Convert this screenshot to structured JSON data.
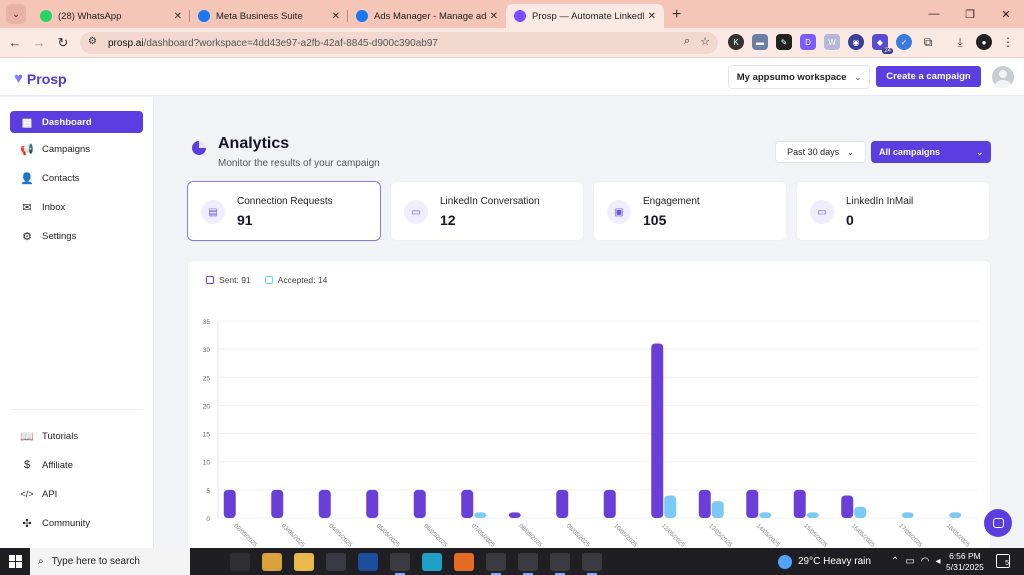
{
  "browser": {
    "tabs": [
      {
        "title": "(28) WhatsApp",
        "color": "#25d366"
      },
      {
        "title": "Meta Business Suite",
        "color": "#1877f2"
      },
      {
        "title": "Ads Manager - Manage ads - C",
        "color": "#1877f2"
      },
      {
        "title": "Prosp — Automate LinkedIn &",
        "color": "#7b4dff"
      }
    ],
    "url_host": "prosp.ai",
    "url_path": "/dashboard?workspace=4dd43e97-a2fb-42af-8845-d900c390ab97",
    "extension_badge": "24"
  },
  "header": {
    "logo": "Prosp",
    "workspace": "My appsumo workspace",
    "create_campaign": "Create a campaign"
  },
  "sidebar": {
    "items": [
      {
        "label": "Dashboard",
        "icon": "grid-icon",
        "glyph": "▦"
      },
      {
        "label": "Campaigns",
        "icon": "megaphone-icon",
        "glyph": "📢"
      },
      {
        "label": "Contacts",
        "icon": "contact-card-icon",
        "glyph": "👤"
      },
      {
        "label": "Inbox",
        "icon": "mail-icon",
        "glyph": "✉"
      },
      {
        "label": "Settings",
        "icon": "gear-icon",
        "glyph": "⚙"
      }
    ],
    "bottom_items": [
      {
        "label": "Tutorials",
        "icon": "book-icon",
        "glyph": "📖"
      },
      {
        "label": "Affiliate",
        "icon": "dollar-icon",
        "glyph": "$"
      },
      {
        "label": "API",
        "icon": "code-icon",
        "glyph": "</>"
      },
      {
        "label": "Community",
        "icon": "slack-icon",
        "glyph": "✣"
      }
    ]
  },
  "analytics": {
    "title": "Analytics",
    "subtitle": "Monitor the results of your campaign",
    "range": "Past 30 days",
    "campaign_filter": "All campaigns"
  },
  "stats": [
    {
      "label": "Connection Requests",
      "value": "91"
    },
    {
      "label": "LinkedIn Conversation",
      "value": "12"
    },
    {
      "label": "Engagement",
      "value": "105"
    },
    {
      "label": "LinkedIn InMail",
      "value": "0"
    }
  ],
  "legend": {
    "sent": "Sent: 91",
    "accepted": "Accepted: 14"
  },
  "colors": {
    "accent": "#5b3ee0",
    "sent": "#6a3fd8",
    "accepted": "#7cc9f6"
  },
  "chart_data": {
    "type": "bar",
    "categories": [
      "02/05/2025",
      "03/05/2025",
      "04/05/2025",
      "05/05/2025",
      "06/05/2025",
      "07/05/2025",
      "08/05/2025",
      "09/05/2025",
      "10/05/2025",
      "12/05/2025",
      "13/05/2025",
      "14/05/2025",
      "15/05/2025",
      "16/05/2025",
      "17/05/2025",
      "18/05/2025"
    ],
    "series": [
      {
        "name": "Sent",
        "values": [
          5,
          5,
          5,
          5,
          5,
          5,
          1,
          5,
          5,
          31,
          5,
          5,
          5,
          4,
          0,
          0
        ]
      },
      {
        "name": "Accepted",
        "values": [
          0,
          0,
          0,
          0,
          0,
          1,
          0,
          0,
          0,
          4,
          3,
          1,
          1,
          2,
          1,
          1
        ]
      }
    ],
    "ylim": [
      0,
      35
    ],
    "yticks": [
      "0",
      "5",
      "10",
      "15",
      "20",
      "25",
      "30",
      "35"
    ],
    "grid": true
  },
  "taskbar": {
    "search_placeholder": "Type here to search",
    "weather": "29°C  Heavy rain",
    "time": "6:56 PM",
    "date": "5/31/2025",
    "notifications": "5"
  }
}
